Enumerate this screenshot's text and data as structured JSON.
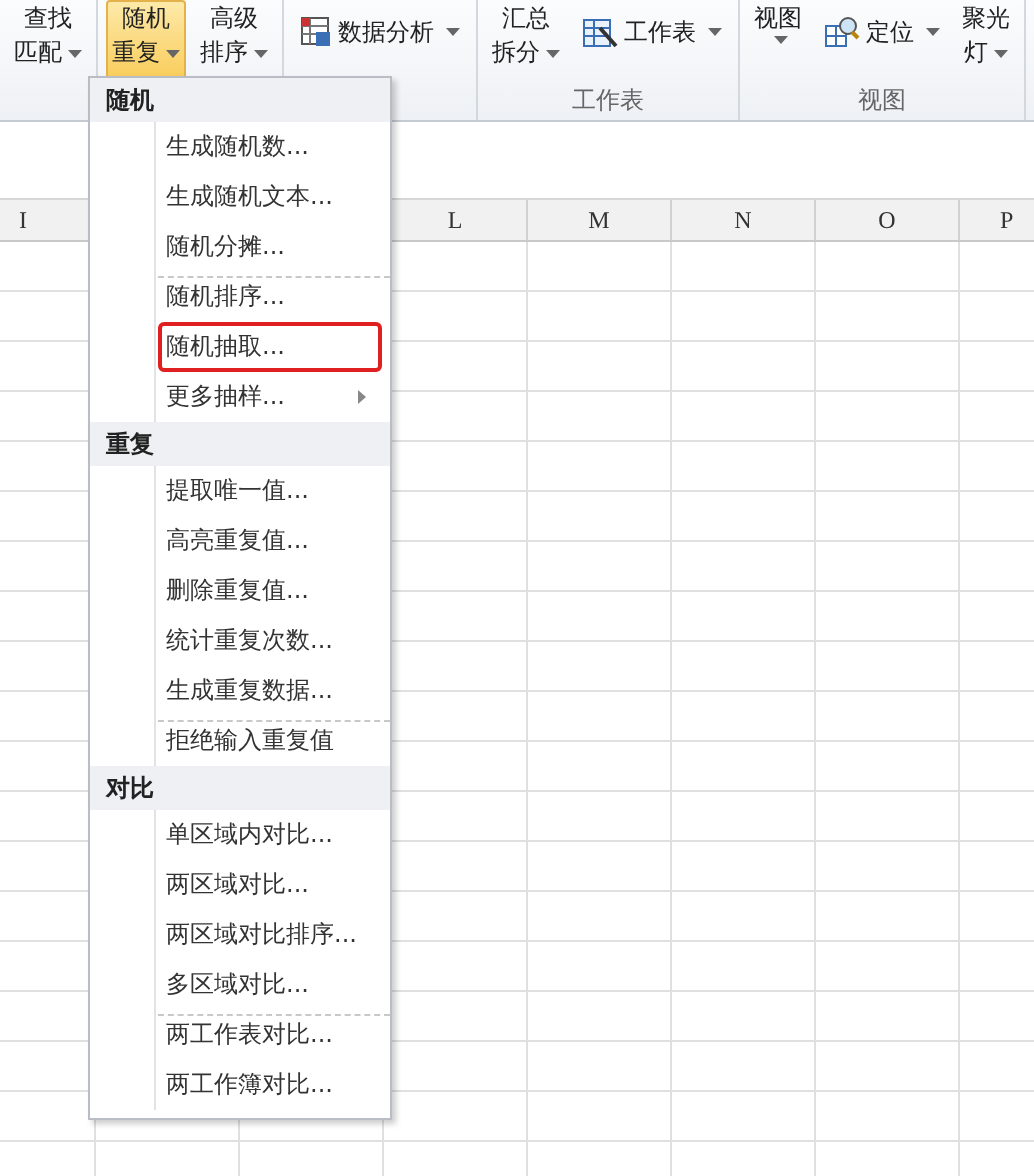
{
  "ribbon": {
    "groups": [
      {
        "items": [
          {
            "kind": "large",
            "lines": [
              "查找",
              "匹配"
            ],
            "dropdown": true,
            "selected": false
          }
        ]
      },
      {
        "items": [
          {
            "kind": "large",
            "lines": [
              "随机",
              "重复"
            ],
            "dropdown": true,
            "selected": true
          },
          {
            "kind": "large",
            "lines": [
              "高级",
              "排序"
            ],
            "dropdown": true,
            "selected": false
          }
        ]
      },
      {
        "items": [
          {
            "kind": "small",
            "label": "数据分析",
            "dropdown": true,
            "selected": false
          }
        ]
      },
      {
        "label": "工作表",
        "items": [
          {
            "kind": "large",
            "lines": [
              "汇总",
              "拆分"
            ],
            "dropdown": true,
            "selected": false
          },
          {
            "kind": "small",
            "label": "工作表",
            "dropdown": true,
            "selected": false
          }
        ]
      },
      {
        "label": "视图",
        "items": [
          {
            "kind": "large",
            "lines": [
              "视图"
            ],
            "dropdown": true,
            "selected": false
          },
          {
            "kind": "small",
            "label": "定位",
            "dropdown": true,
            "selected": false
          },
          {
            "kind": "large",
            "lines": [
              "聚光",
              "灯"
            ],
            "dropdown": true,
            "selected": false
          }
        ]
      }
    ]
  },
  "columns": [
    "I",
    "L",
    "M",
    "N",
    "O",
    "P"
  ],
  "menu": {
    "sections": [
      {
        "title": "随机",
        "items": [
          {
            "label": "生成随机数...",
            "separator_before": false,
            "highlighted": false,
            "submenu": false
          },
          {
            "label": "生成随机文本...",
            "separator_before": false,
            "highlighted": false,
            "submenu": false
          },
          {
            "label": "随机分摊...",
            "separator_before": false,
            "highlighted": false,
            "submenu": false
          },
          {
            "label": "随机排序...",
            "separator_before": true,
            "highlighted": false,
            "submenu": false
          },
          {
            "label": "随机抽取...",
            "separator_before": false,
            "highlighted": true,
            "submenu": false
          },
          {
            "label": "更多抽样...",
            "separator_before": false,
            "highlighted": false,
            "submenu": true
          }
        ]
      },
      {
        "title": "重复",
        "items": [
          {
            "label": "提取唯一值...",
            "separator_before": false,
            "highlighted": false,
            "submenu": false
          },
          {
            "label": "高亮重复值...",
            "separator_before": false,
            "highlighted": false,
            "submenu": false
          },
          {
            "label": "删除重复值...",
            "separator_before": false,
            "highlighted": false,
            "submenu": false
          },
          {
            "label": "统计重复次数...",
            "separator_before": false,
            "highlighted": false,
            "submenu": false
          },
          {
            "label": "生成重复数据...",
            "separator_before": false,
            "highlighted": false,
            "submenu": false
          },
          {
            "label": "拒绝输入重复值",
            "separator_before": true,
            "highlighted": false,
            "submenu": false
          }
        ]
      },
      {
        "title": "对比",
        "items": [
          {
            "label": "单区域内对比...",
            "separator_before": false,
            "highlighted": false,
            "submenu": false
          },
          {
            "label": "两区域对比...",
            "separator_before": false,
            "highlighted": false,
            "submenu": false
          },
          {
            "label": "两区域对比排序...",
            "separator_before": false,
            "highlighted": false,
            "submenu": false
          },
          {
            "label": "多区域对比...",
            "separator_before": false,
            "highlighted": false,
            "submenu": false
          },
          {
            "label": "两工作表对比...",
            "separator_before": true,
            "highlighted": false,
            "submenu": false
          },
          {
            "label": "两工作簿对比...",
            "separator_before": false,
            "highlighted": false,
            "submenu": false
          }
        ]
      }
    ]
  }
}
